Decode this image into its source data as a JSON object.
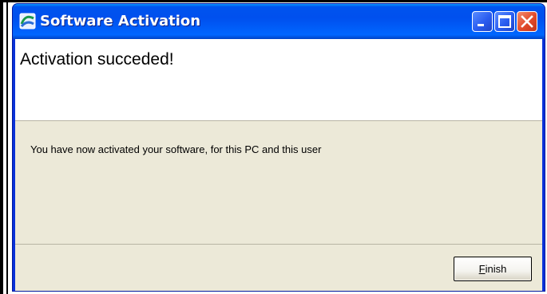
{
  "window": {
    "title": "Software Activation",
    "title_icon": "app-logo-icon",
    "controls": {
      "minimize_icon": "minimize-icon",
      "maximize_icon": "maximize-icon",
      "close_icon": "close-icon"
    },
    "colors": {
      "titlebar": "#0054e3",
      "close_button": "#e24a2a",
      "body": "#ece9d8"
    }
  },
  "header": {
    "title": "Activation succeded!"
  },
  "content": {
    "message": "You have now activated your software, for this PC and this user"
  },
  "footer": {
    "finish_accel": "F",
    "finish_rest": "inish"
  }
}
